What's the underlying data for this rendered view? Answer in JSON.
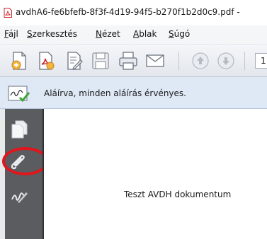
{
  "window": {
    "title": "avdhA6-fe6bfefb-8f3f-4d19-94f5-b270f1b2d0c9.pdf -"
  },
  "menu": [
    {
      "label": "Fájl"
    },
    {
      "label": "Szerkesztés"
    },
    {
      "label": "Nézet"
    },
    {
      "label": "Ablak"
    },
    {
      "label": "Súgó"
    }
  ],
  "toolbar": {
    "buttons": [
      {
        "icon": "create-pdf-icon"
      },
      {
        "icon": "open-file-icon"
      },
      {
        "icon": "edit-document-icon"
      },
      {
        "icon": "save-icon"
      },
      {
        "icon": "print-icon"
      },
      {
        "icon": "email-icon"
      },
      {
        "icon": "page-up-icon"
      },
      {
        "icon": "page-down-icon"
      }
    ],
    "page_number": "1"
  },
  "signature_bar": {
    "text": "Aláírva, minden aláírás érvényes."
  },
  "navigation_pane": {
    "buttons": [
      {
        "icon": "pages-icon"
      },
      {
        "icon": "attachments-icon",
        "highlighted": true
      },
      {
        "icon": "signatures-icon"
      }
    ],
    "highlight_color": "#e0161c"
  },
  "document": {
    "text": "Teszt AVDH dokumentum"
  }
}
